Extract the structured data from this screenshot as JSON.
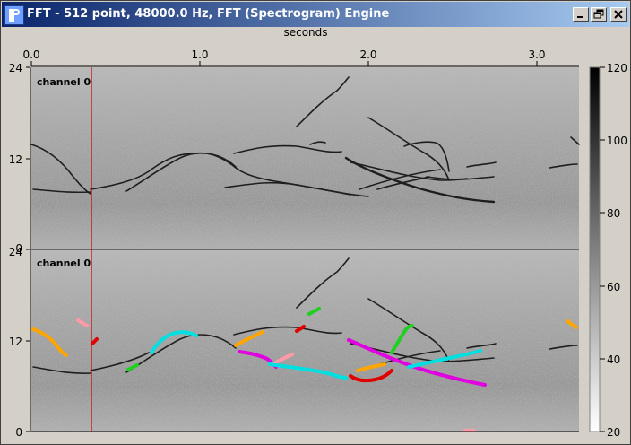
{
  "window": {
    "title": "FFT - 512 point, 48000.0 Hz, FFT (Spectrogram) Engine",
    "icon": "app-logo-icon",
    "controls": [
      "minimize-icon",
      "restore-icon",
      "close-icon"
    ]
  },
  "time_axis": {
    "label": "seconds",
    "ticks": [
      "0.0",
      "1.0",
      "2.0",
      "3.0"
    ]
  },
  "panels": [
    {
      "label": "channel 0",
      "ticks": [
        "24",
        "12",
        "0"
      ]
    },
    {
      "label": "channel 0",
      "ticks": [
        "24",
        "12",
        "0"
      ]
    }
  ],
  "colorbar": {
    "ticks": [
      "120",
      "100",
      "80",
      "60",
      "40",
      "20"
    ]
  },
  "cursor": {
    "color": "#cc0000"
  },
  "colors": {
    "title_gradient_start": "#0a246a",
    "title_gradient_end": "#a6caf0",
    "background": "#d4d0c8",
    "annotation_orange": "#ffa500",
    "annotation_cyan": "#00e0e0",
    "annotation_magenta": "#e000e0",
    "annotation_red": "#e00000",
    "annotation_green": "#20d020",
    "annotation_pink": "#ff9aa8"
  }
}
